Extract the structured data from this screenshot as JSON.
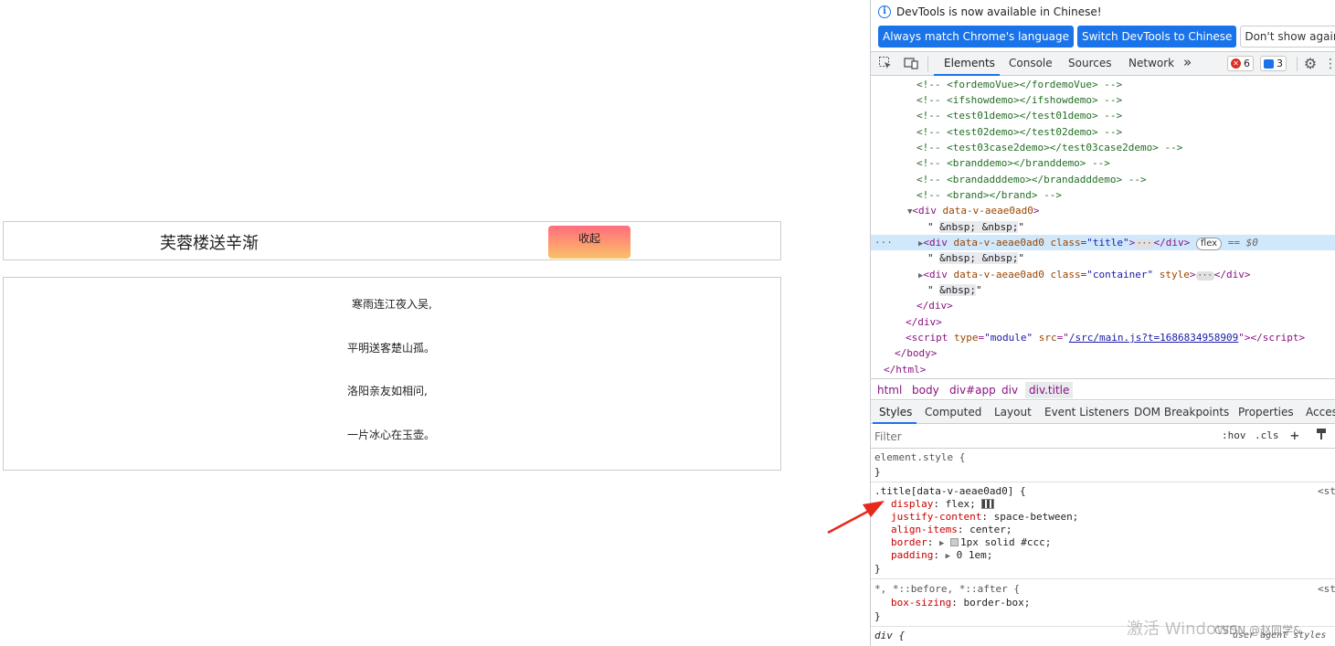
{
  "page": {
    "title": "芙蓉楼送辛渐",
    "collapse_label": "收起",
    "poem": [
      "寒雨连江夜入吴,",
      "平明送客楚山孤。",
      "洛阳亲友如相问,",
      "一片冰心在玉壶。"
    ]
  },
  "devtools": {
    "info_text": "DevTools is now available in Chinese!",
    "buttons": [
      "Always match Chrome's language",
      "Switch DevTools to Chinese",
      "Don't show again"
    ],
    "tabs": [
      "Elements",
      "Console",
      "Sources",
      "Network"
    ],
    "more_tabs": "»",
    "errors_count": "6",
    "messages_count": "3",
    "dom": {
      "comments": [
        "<!-- <fordemoVue></fordemoVue> -->",
        "<!-- <ifshowdemo></ifshowdemo> -->",
        "<!-- <test01demo></test01demo> -->",
        "<!-- <test02demo></test02demo> -->",
        "<!-- <test03case2demo></test03case2demo> -->",
        "<!-- <branddemo></branddemo> -->",
        "<!-- <brandadddemo></brandadddemo> -->",
        "<!-- <brand></brand> -->"
      ],
      "div_open": "<div",
      "div_attr": "data-v-aeae0ad0",
      "div_close_bracket": ">",
      "nbsp2": "&nbsp; &nbsp;",
      "nbsp1": "&nbsp;",
      "sel_class_val": "\"title\"",
      "container_class_val": "\"container\"",
      "attr_class": "class",
      "attr_style": "style",
      "close_div": "</div>",
      "flex_badge": "flex",
      "eq0": "== $0",
      "script_type_val": "\"module\"",
      "script_src_link": "/src/main.js?t=1686834958909",
      "close_body": "</body>",
      "close_html": "</html>"
    },
    "breadcrumbs": [
      "html",
      "body",
      "div#app",
      "div",
      "div.title"
    ],
    "subtabs": [
      "Styles",
      "Computed",
      "Layout",
      "Event Listeners",
      "DOM Breakpoints",
      "Properties",
      "Accessibility"
    ],
    "filter_placeholder": "Filter",
    "filter_tools": [
      ":hov",
      ".cls"
    ],
    "styles": {
      "element_style": "element.style {",
      "close_brace": "}",
      "title_selector": ".title[data-v-aeae0ad0] {",
      "title_rules": [
        {
          "prop": "display",
          "val": "flex;"
        },
        {
          "prop": "justify-content",
          "val": "space-between;"
        },
        {
          "prop": "align-items",
          "val": "center;"
        },
        {
          "prop": "border",
          "val": "1px solid  #ccc;"
        },
        {
          "prop": "padding",
          "val": "0 1em;"
        }
      ],
      "star_selector": "*, *::before, *::after {",
      "star_rule": {
        "prop": "box-sizing",
        "val": "border-box;"
      },
      "div_selector": "div {",
      "source_link": "<st",
      "user_agent": "user agent styles"
    },
    "watermark": "激活 Windows",
    "csdn": "CSDN @赵同学&"
  },
  "colors": {
    "accent": "#1a73e8",
    "arrow": "#e8281d"
  }
}
